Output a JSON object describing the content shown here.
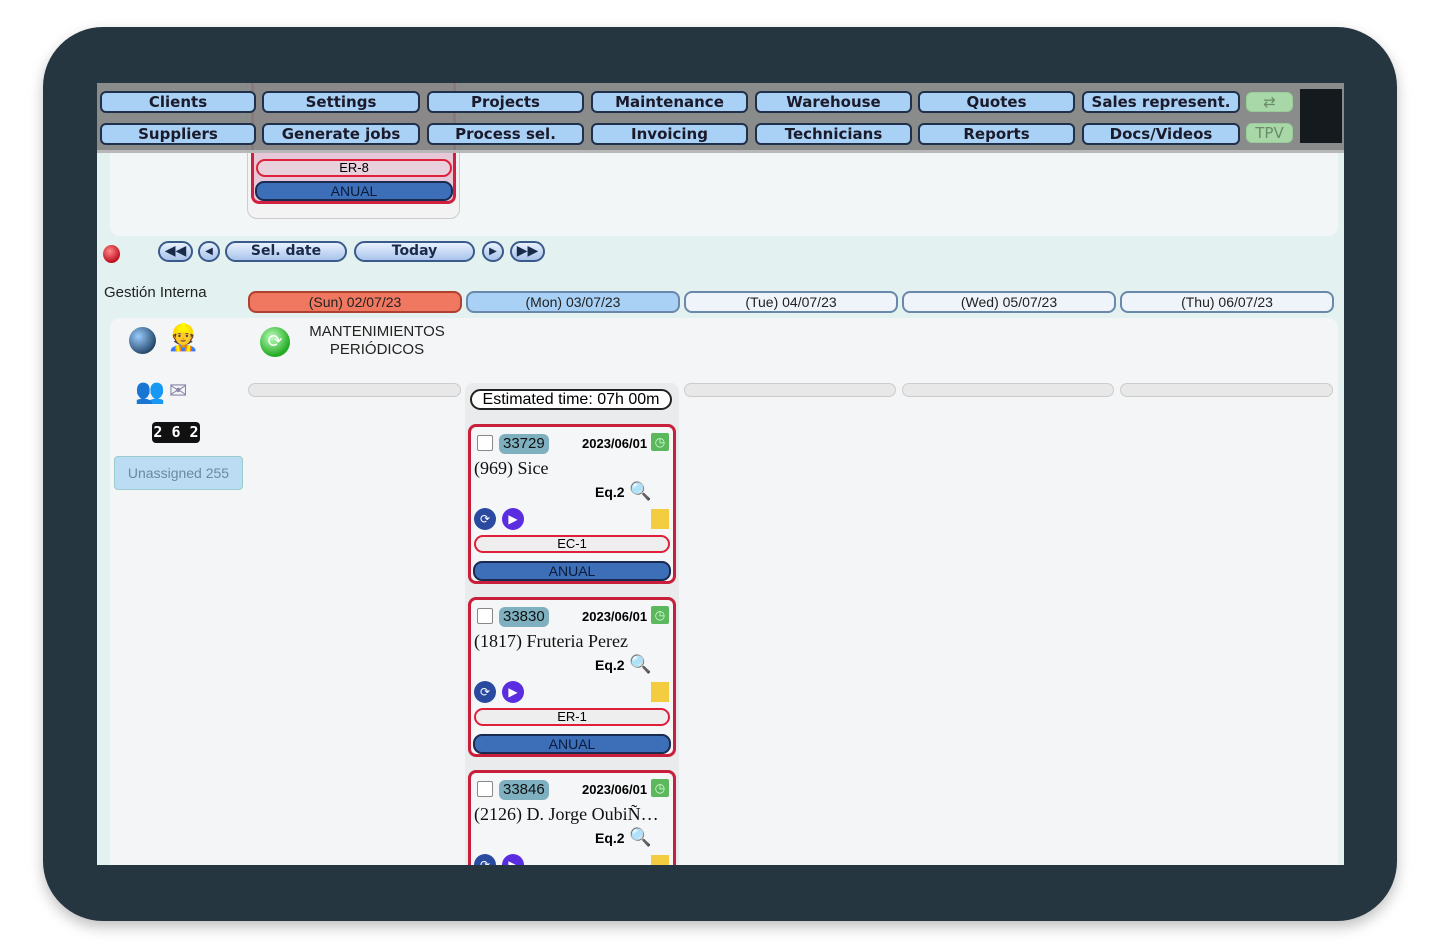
{
  "nav": {
    "row1": [
      "Clients",
      "Settings",
      "Projects",
      "Maintenance",
      "Warehouse",
      "Quotes",
      "Sales represent."
    ],
    "row2": [
      "Suppliers",
      "Generate jobs",
      "Process sel.",
      "Invoicing",
      "Technicians",
      "Reports",
      "Docs/Videos"
    ],
    "swap_icon": "⇄",
    "tpv": "TPV"
  },
  "bg_card": {
    "code": "ER-8",
    "freq": "ANUAL"
  },
  "date_nav": {
    "sel_date": "Sel. date",
    "today": "Today"
  },
  "group": "Gestión Interna",
  "days": [
    "(Sun) 02/07/23",
    "(Mon) 03/07/23",
    "(Tue) 04/07/23",
    "(Wed) 05/07/23",
    "(Thu) 06/07/23"
  ],
  "section_title_1": "MANTENIMIENTOS",
  "section_title_2": "PERIÓDICOS",
  "counter": "2 6 2",
  "unassigned": "Unassigned 255",
  "estimated": "Estimated time: 07h 00m",
  "jobs": [
    {
      "id": "33729",
      "date": "2023/06/01",
      "client": "(969) Sice",
      "eq": "Eq.2",
      "code": "EC-1",
      "freq": "ANUAL"
    },
    {
      "id": "33830",
      "date": "2023/06/01",
      "client": "(1817) Fruteria Perez",
      "eq": "Eq.2",
      "code": "ER-1",
      "freq": "ANUAL"
    },
    {
      "id": "33846",
      "date": "2023/06/01",
      "client": "(2126) D. Jorge OubiÑ…",
      "eq": "Eq.2"
    }
  ],
  "colors": {
    "today": "#f07860",
    "selected": "#a9d0f5",
    "border": "#c8203a"
  }
}
